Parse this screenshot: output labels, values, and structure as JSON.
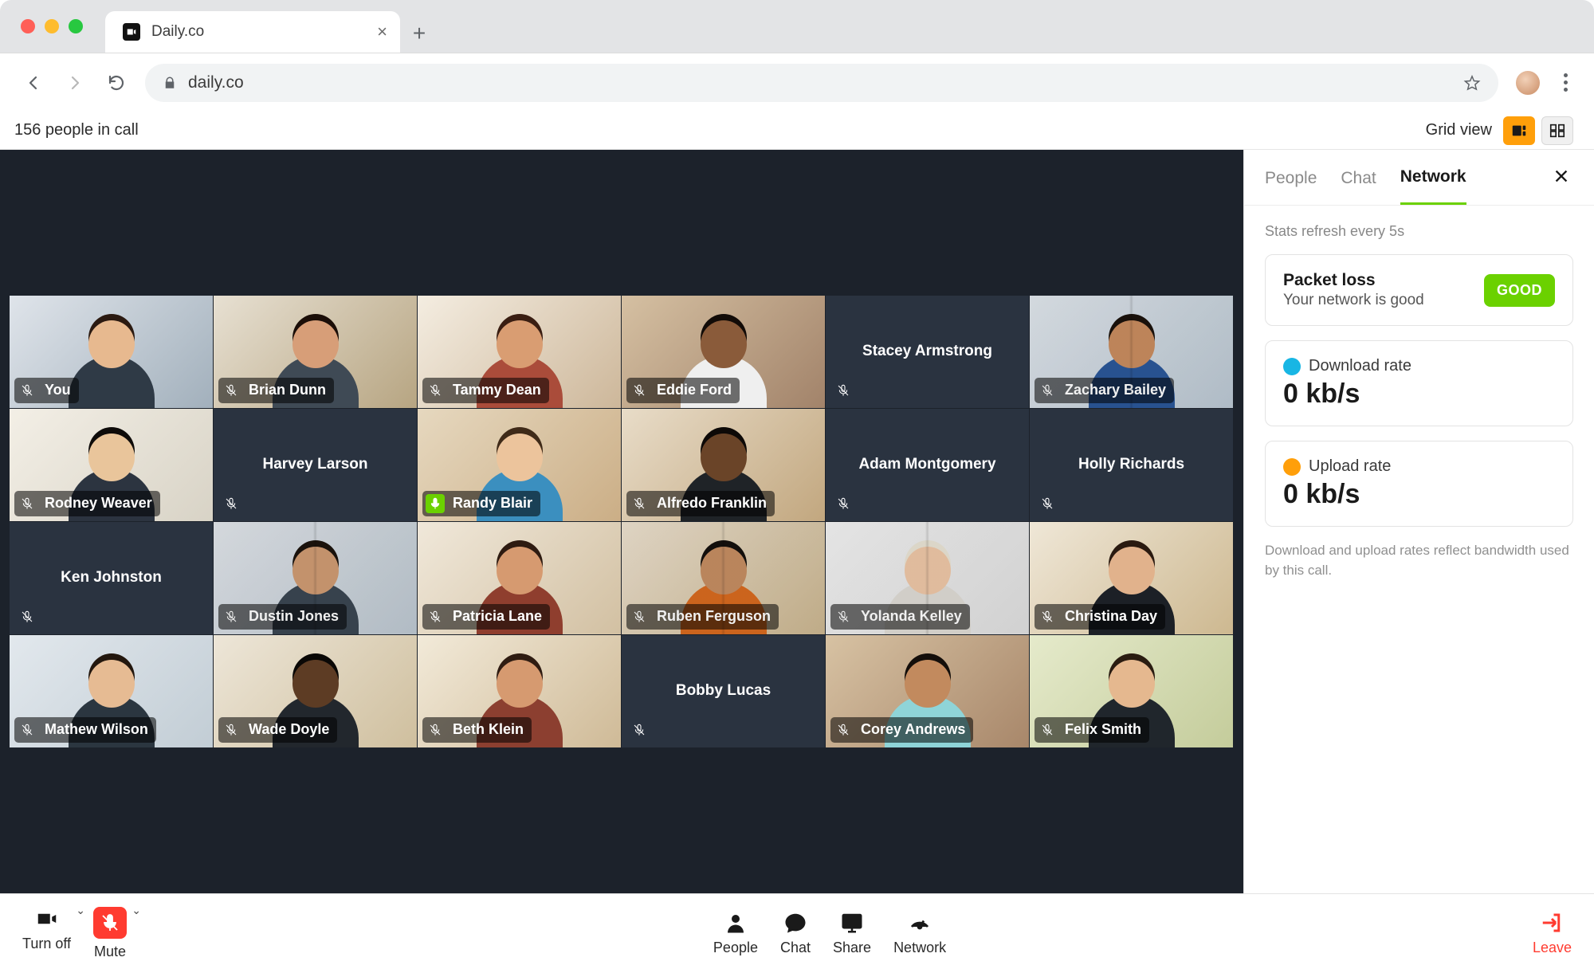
{
  "browser": {
    "tab_title": "Daily.co",
    "url": "daily.co"
  },
  "topbar": {
    "call_count": "156 people in call",
    "view_label": "Grid view"
  },
  "participants": [
    {
      "name": "You",
      "cam": true,
      "mic": "muted",
      "g1": "#dfe4ea",
      "g2": "#a2b0bc",
      "shirt": "#2f3a46",
      "hair": "#2b1a11",
      "skin": "#e7b98f"
    },
    {
      "name": "Brian Dunn",
      "cam": true,
      "mic": "muted",
      "g1": "#e7e0d2",
      "g2": "#b7a582",
      "shirt": "#3f4a55",
      "hair": "#1b0e08",
      "skin": "#d79e78"
    },
    {
      "name": "Tammy Dean",
      "cam": true,
      "mic": "muted",
      "g1": "#f4ede1",
      "g2": "#cdb79a",
      "shirt": "#aa4c3a",
      "hair": "#3a1e12",
      "skin": "#d99d72"
    },
    {
      "name": "Eddie Ford",
      "cam": true,
      "mic": "muted",
      "g1": "#d5c0a2",
      "g2": "#a2836a",
      "shirt": "#efefef",
      "hair": "#120b07",
      "skin": "#8a5b3a"
    },
    {
      "name": "Stacey Armstrong",
      "cam": false,
      "mic": "muted"
    },
    {
      "name": "Zachary Bailey",
      "cam": true,
      "mic": "muted",
      "multi": true,
      "g1": "#e0e6ec",
      "g2": "#bac7d2",
      "shirt": "#2b5799",
      "hair": "#1b120c",
      "skin": "#c98c5f"
    },
    {
      "name": "Rodney Weaver",
      "cam": true,
      "mic": "muted",
      "g1": "#f3efe6",
      "g2": "#d8d3c6",
      "shirt": "#2c3440",
      "hair": "#0e0b09",
      "skin": "#e9c59b"
    },
    {
      "name": "Harvey Larson",
      "cam": false,
      "mic": "muted"
    },
    {
      "name": "Randy Blair",
      "cam": true,
      "mic": "live",
      "g1": "#e6d8bf",
      "g2": "#cbae86",
      "shirt": "#3b8fbf",
      "hair": "#3f2a18",
      "skin": "#ecc49c"
    },
    {
      "name": "Alfredo Franklin",
      "cam": true,
      "mic": "muted",
      "g1": "#e8dcc8",
      "g2": "#c2a77f",
      "shirt": "#1f2327",
      "hair": "#0d0907",
      "skin": "#6a4428"
    },
    {
      "name": "Adam Montgomery",
      "cam": false,
      "mic": "muted"
    },
    {
      "name": "Holly Richards",
      "cam": false,
      "mic": "muted"
    },
    {
      "name": "Ken Johnston",
      "cam": false,
      "mic": "muted"
    },
    {
      "name": "Dustin Jones",
      "cam": true,
      "mic": "muted",
      "multi": true,
      "g1": "#e1e5ea",
      "g2": "#bcc7d0",
      "shirt": "#3a4652",
      "hair": "#1b130d",
      "skin": "#cf9b73"
    },
    {
      "name": "Patricia Lane",
      "cam": true,
      "mic": "muted",
      "g1": "#f0e8da",
      "g2": "#d2c0a2",
      "shirt": "#8f3e2e",
      "hair": "#2e1b11",
      "skin": "#d69a70"
    },
    {
      "name": "Ruben Ferguson",
      "cam": true,
      "mic": "muted",
      "multi": true,
      "g1": "#ece1cf",
      "g2": "#cbb690",
      "shirt": "#d86a1f",
      "hair": "#14100d",
      "skin": "#c58d62"
    },
    {
      "name": "Yolanda Kelley",
      "cam": true,
      "mic": "muted",
      "multi": true,
      "g1": "#f2f2f2",
      "g2": "#dedede",
      "shirt": "#dedbd4",
      "hair": "#e9e3d4",
      "skin": "#eec7a7"
    },
    {
      "name": "Christina Day",
      "cam": true,
      "mic": "muted",
      "g1": "#efe7d7",
      "g2": "#cdb890",
      "shirt": "#1c2026",
      "hair": "#2a1a10",
      "skin": "#e1b28c"
    },
    {
      "name": "Mathew Wilson",
      "cam": true,
      "mic": "muted",
      "g1": "#e2e8ed",
      "g2": "#c2cdd5",
      "shirt": "#2b3640",
      "hair": "#23170e",
      "skin": "#e6bb93"
    },
    {
      "name": "Wade Doyle",
      "cam": true,
      "mic": "muted",
      "g1": "#ede6d8",
      "g2": "#cfbf9e",
      "shirt": "#22272d",
      "hair": "#0a0806",
      "skin": "#5d3c24"
    },
    {
      "name": "Beth Klein",
      "cam": true,
      "mic": "muted",
      "g1": "#f2ead9",
      "g2": "#cfba97",
      "shirt": "#8c3f30",
      "hair": "#2f1c12",
      "skin": "#d69a70"
    },
    {
      "name": "Bobby Lucas",
      "cam": false,
      "mic": "muted"
    },
    {
      "name": "Corey Andrews",
      "cam": true,
      "mic": "muted",
      "g1": "#d7c2a3",
      "g2": "#a8876a",
      "shirt": "#8fd4d8",
      "hair": "#140e0a",
      "skin": "#c28a5e"
    },
    {
      "name": "Felix Smith",
      "cam": true,
      "mic": "muted",
      "g1": "#e5eacb",
      "g2": "#c4cc9b",
      "shirt": "#20262c",
      "hair": "#2a1c11",
      "skin": "#e5b88f"
    }
  ],
  "panel": {
    "tabs": {
      "people": "People",
      "chat": "Chat",
      "network": "Network"
    },
    "refresh_note": "Stats refresh every 5s",
    "packet_loss": {
      "title": "Packet loss",
      "subtitle": "Your network is good",
      "badge": "GOOD"
    },
    "download": {
      "label": "Download rate",
      "value": "0 kb/s",
      "color": "#18b6e4"
    },
    "upload": {
      "label": "Upload rate",
      "value": "0 kb/s",
      "color": "#ff9f0a"
    },
    "footnote": "Download and upload rates reflect bandwidth used by this call."
  },
  "toolbar": {
    "turn_off": "Turn off",
    "mute": "Mute",
    "people": "People",
    "chat": "Chat",
    "share": "Share",
    "network": "Network",
    "leave": "Leave"
  }
}
